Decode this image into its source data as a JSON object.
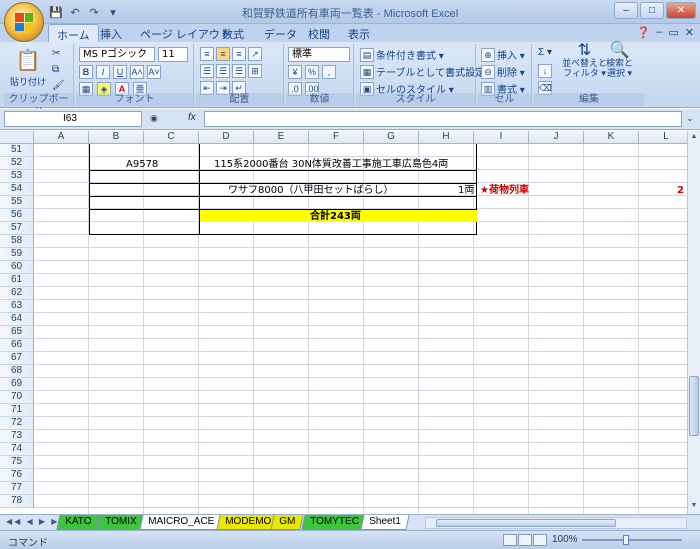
{
  "window": {
    "title": "和賀野鉄道所有車両一覧表 - Microsoft Excel",
    "minimize": "–",
    "maximize": "□",
    "close": "✕"
  },
  "qat": [
    "save-icon",
    "undo-icon",
    "redo-icon",
    "customize-icon"
  ],
  "tabs": [
    "ホーム",
    "挿入",
    "ページ レイアウト",
    "数式",
    "データ",
    "校閲",
    "表示"
  ],
  "ribbon": {
    "clipboard": {
      "label": "クリップボード",
      "paste": "貼り付け"
    },
    "font": {
      "label": "フォント",
      "name": "MS Pゴシック",
      "size": "11",
      "bold": "B",
      "italic": "I",
      "underline": "U",
      "grow": "A˄",
      "shrink": "A˅"
    },
    "alignment": {
      "label": "配置"
    },
    "number": {
      "label": "数値",
      "format": "標準",
      "percent": "%",
      "comma": ","
    },
    "styles": {
      "label": "スタイル",
      "conditional": "条件付き書式 ▾",
      "table": "テーブルとして書式設定 ▾",
      "cell": "セルのスタイル ▾"
    },
    "cells": {
      "label": "セル",
      "insert": "挿入 ▾",
      "delete": "削除 ▾",
      "format": "書式 ▾"
    },
    "editing": {
      "label": "編集",
      "sum": "Σ ▾",
      "sort": "並べ替えと\nフィルタ ▾",
      "find": "検索と\n選択 ▾"
    }
  },
  "formula_bar": {
    "name_box": "I63",
    "fx": "fx",
    "value": ""
  },
  "columns": [
    "A",
    "B",
    "C",
    "D",
    "E",
    "F",
    "G",
    "H",
    "I",
    "J",
    "K",
    "L"
  ],
  "rows": [
    "51",
    "52",
    "53",
    "54",
    "55",
    "56",
    "57",
    "58",
    "59",
    "60",
    "61",
    "62",
    "63",
    "64",
    "65",
    "66",
    "67",
    "68",
    "69",
    "70",
    "71",
    "72",
    "73",
    "74",
    "75",
    "76",
    "77",
    "78"
  ],
  "cells": {
    "b52": "A9578",
    "d52": "115系2000番台  30N体質改善工事施工車広島色4両",
    "d54": "ワサフ8000（八甲田セットばらし）",
    "h54": "1両",
    "i54": "★荷物列車",
    "l54": "2",
    "d55": "合計243両"
  },
  "colors": {
    "total_fill": "#ffff00",
    "accent_text": "#cc0000"
  },
  "sheet_tabs": [
    {
      "label": "KATO",
      "color": "#3cc63c"
    },
    {
      "label": "TOMIX",
      "color": "#3cc63c"
    },
    {
      "label": "MAICRO_ACE",
      "color": "#ffffff"
    },
    {
      "label": "MODEMO",
      "color": "#e8e800"
    },
    {
      "label": "GM",
      "color": "#e8e800"
    },
    {
      "label": "TOMYTEC",
      "color": "#3cc63c"
    },
    {
      "label": "Sheet1",
      "color": "#ffffff"
    }
  ],
  "status": {
    "mode": "コマンド",
    "zoom": "100%"
  }
}
